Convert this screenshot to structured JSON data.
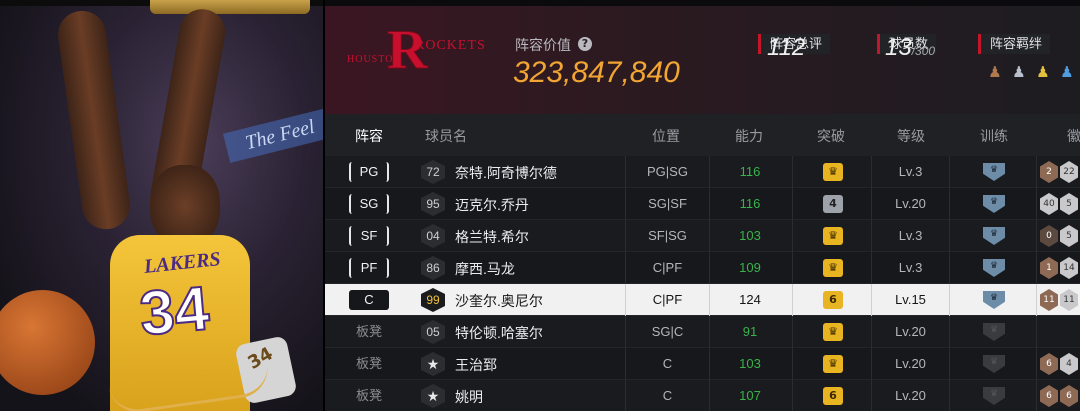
{
  "team": {
    "logo_text": "HOUSTON ROCKETS",
    "logo_letter": "R",
    "logo_houston": "HOUSTON",
    "logo_rockets": "ROCKETS"
  },
  "hero": {
    "jersey_name": "LAKERS",
    "jersey_number": "34",
    "banner_text": "The Feel"
  },
  "header": {
    "lineup_value_label": "阵容价值",
    "help_icon": "?",
    "lineup_value": "323,847,840",
    "stats": [
      {
        "label": "阵容总评",
        "value": "112"
      },
      {
        "label": "球员数",
        "value": "13",
        "suffix": "/300"
      },
      {
        "label": "阵容羁绊"
      }
    ],
    "chemistry_icons": [
      "bronze-team-icon",
      "silver-team-icon",
      "gold-team-icon",
      "blue-team-icon"
    ]
  },
  "table": {
    "headers": [
      "阵容",
      "球员名",
      "位置",
      "能力",
      "突破",
      "等级",
      "训练",
      "徽"
    ],
    "rows": [
      {
        "slot": "PG",
        "rating": "72",
        "name": "奈特.阿奇博尔德",
        "position": "PG|SG",
        "power": "116",
        "breakthrough": "crown",
        "level": "Lv.3",
        "training": "crown",
        "chips": [
          "2",
          "22"
        ]
      },
      {
        "slot": "SG",
        "rating": "95",
        "name": "迈克尔.乔丹",
        "position": "SG|SF",
        "power": "116",
        "breakthrough": "4",
        "level": "Lv.20",
        "training": "crown",
        "chips": [
          "40",
          "5"
        ]
      },
      {
        "slot": "SF",
        "rating": "04",
        "name": "格兰特.希尔",
        "position": "SF|SG",
        "power": "103",
        "breakthrough": "crown",
        "level": "Lv.3",
        "training": "crown",
        "chips": [
          "0",
          "5"
        ]
      },
      {
        "slot": "PF",
        "rating": "86",
        "name": "摩西.马龙",
        "position": "C|PF",
        "power": "109",
        "breakthrough": "crown",
        "level": "Lv.3",
        "training": "crown",
        "chips": [
          "1",
          "14"
        ]
      },
      {
        "slot": "C",
        "rating": "99",
        "name": "沙奎尔.奥尼尔",
        "position": "C|PF",
        "power": "124",
        "breakthrough": "6",
        "level": "Lv.15",
        "training": "crown",
        "chips": [
          "11",
          "11"
        ]
      },
      {
        "slot": "板凳",
        "rating": "05",
        "name": "特伦顿.哈塞尔",
        "position": "SG|C",
        "power": "91",
        "breakthrough": "crown",
        "level": "Lv.20",
        "training": "",
        "chips": []
      },
      {
        "slot": "板凳",
        "rating": "★",
        "name": "王治郅",
        "position": "C",
        "power": "103",
        "breakthrough": "crown",
        "level": "Lv.20",
        "training": "",
        "chips": [
          "6",
          "4"
        ]
      },
      {
        "slot": "板凳",
        "rating": "★",
        "name": "姚明",
        "position": "C",
        "power": "107",
        "breakthrough": "6",
        "level": "Lv.20",
        "training": "",
        "chips": [
          "6",
          "6"
        ]
      }
    ]
  },
  "colors": {
    "accent": "#f2a532",
    "team_red": "#c8102e",
    "power_green": "#39b34a",
    "selected_row": "#f1f1f1"
  }
}
